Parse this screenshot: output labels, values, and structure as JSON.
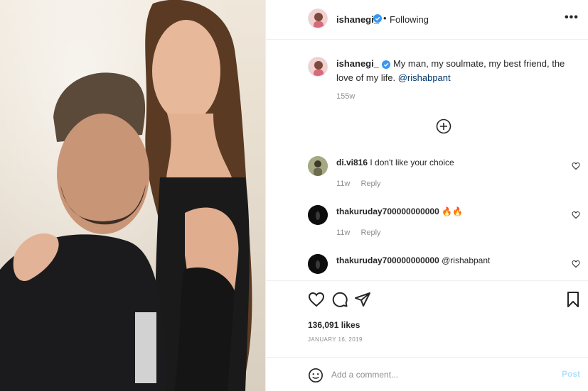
{
  "post": {
    "author": "ishanegi_",
    "follow_status": "Following",
    "more_label": "•••",
    "separator": "•"
  },
  "caption": {
    "username": "ishanegi_",
    "text": "My man, my soulmate, my best friend, the love of my life.",
    "mention": "@rishabpant",
    "time": "155w"
  },
  "comments": [
    {
      "username": "di.vi816",
      "text": "I don't like your choice",
      "time": "11w",
      "reply": "Reply"
    },
    {
      "username": "thakuruday700000000000",
      "text": "🔥🔥",
      "time": "11w",
      "reply": "Reply"
    },
    {
      "username": "thakuruday700000000000",
      "mention": "@rishabpant"
    }
  ],
  "footer": {
    "likes": "136,091 likes",
    "date": "JANUARY 16, 2019",
    "comment_placeholder": "Add a comment...",
    "post_label": "Post"
  },
  "colors": {
    "verified": "#3897f0",
    "mention": "#00376b",
    "post_disabled": "#b2dffc"
  },
  "icons": [
    "verified-badge-icon",
    "more-options-icon",
    "load-more-icon",
    "heart-icon",
    "comment-icon",
    "share-icon",
    "bookmark-icon",
    "emoji-icon"
  ]
}
